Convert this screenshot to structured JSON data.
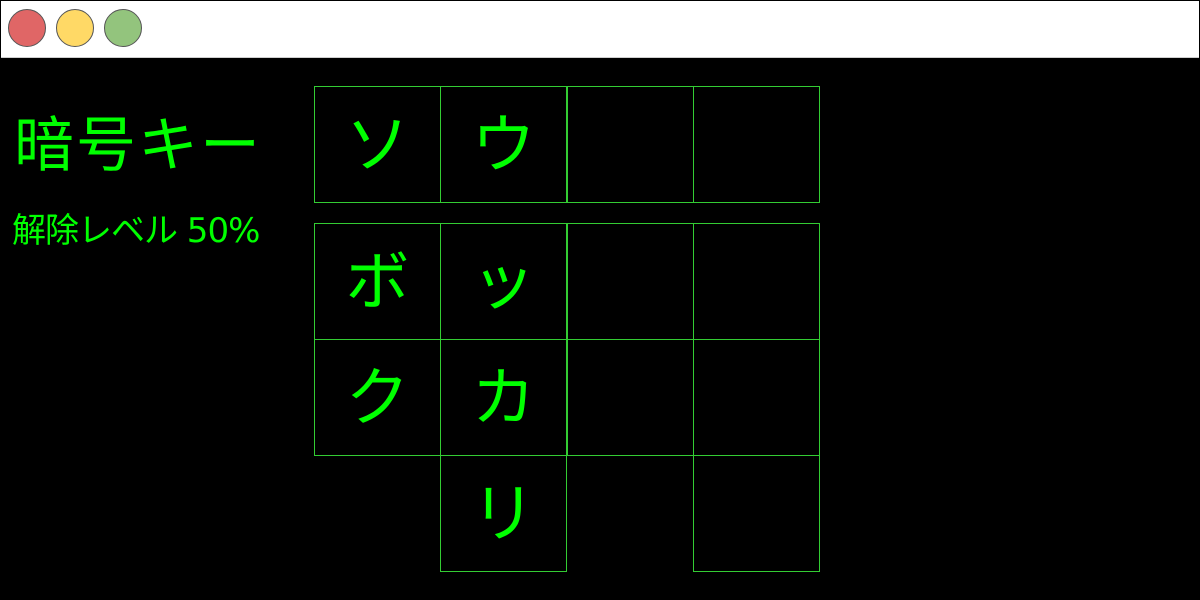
{
  "window": {
    "controls": [
      {
        "name": "close-button",
        "color": "#e06666"
      },
      {
        "name": "minimize-button",
        "color": "#ffd966"
      },
      {
        "name": "maximize-button",
        "color": "#93c47d"
      }
    ]
  },
  "theme": {
    "text_color": "#00ff00",
    "cell_border_color": "#33cc33",
    "background": "#000000"
  },
  "panel": {
    "title": "暗号キー",
    "level_text": "解除レベル 50%"
  },
  "grid": {
    "rows": [
      [
        "ソ",
        "ウ",
        "",
        ""
      ],
      [
        "ボ",
        "ッ",
        "",
        ""
      ],
      [
        "ク",
        "カ",
        "",
        ""
      ],
      [
        null,
        "リ",
        null,
        ""
      ]
    ]
  }
}
